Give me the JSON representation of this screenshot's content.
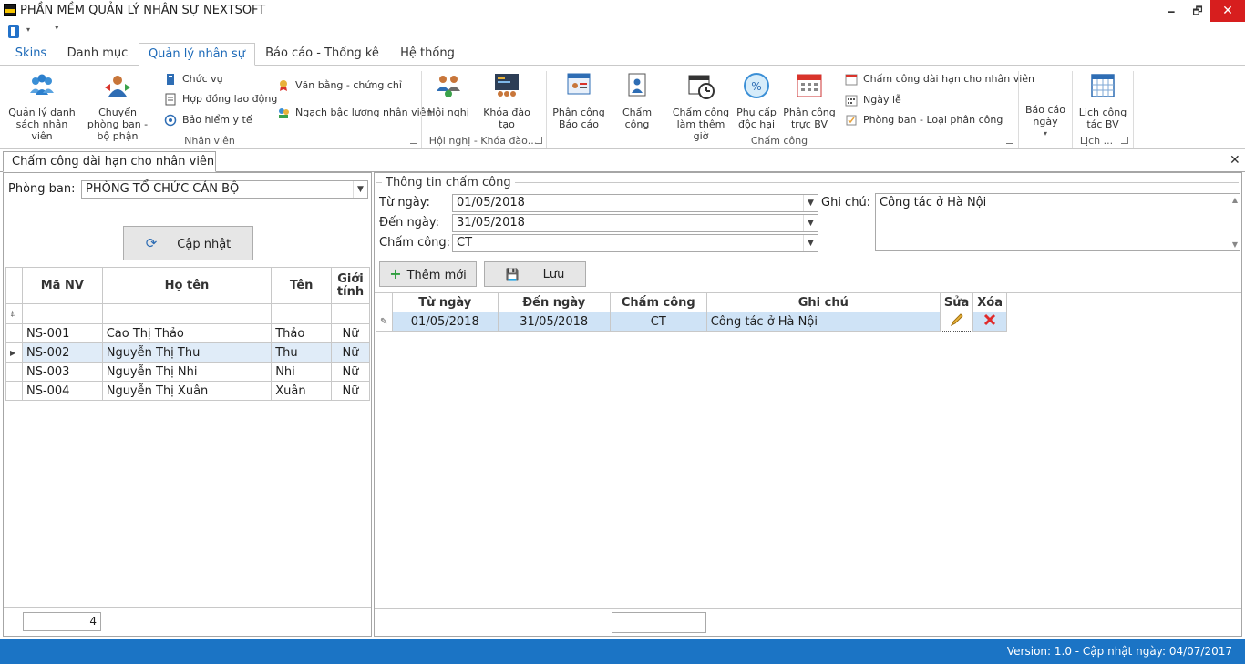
{
  "window": {
    "title": "PHẦN MỀM QUẢN LÝ NHÂN SỰ NEXTSOFT",
    "minimize": "🗕",
    "maximize": "🗗",
    "close": "✕"
  },
  "tabs": [
    "Skins",
    "Danh mục",
    "Quản lý nhân sự",
    "Báo cáo - Thống kê",
    "Hệ thống"
  ],
  "ribbon": {
    "nhanvien": {
      "label": "Nhân viên",
      "qlds": "Quản lý danh sách nhân viên",
      "chuyen": "Chuyển phòng ban - bộ phận",
      "chucvu": "Chức vụ",
      "hopdong": "Hợp đồng lao động",
      "baohiem": "Bảo hiểm y tế",
      "vanbang": "Văn bằng - chứng chỉ",
      "ngach": "Ngạch bậc lương nhân viên"
    },
    "hoinghi": {
      "label": "Hội nghị - Khóa đào...",
      "hoinghi": "Hội nghị",
      "khoadaotao": "Khóa đào tạo"
    },
    "chamcong": {
      "label": "Chấm công",
      "phancong_baocao": "Phân công Báo cáo",
      "chamcong": "Chấm công",
      "lamthemgio": "Chấm công làm thêm giờ",
      "phucap": "Phụ cấp độc hại",
      "phancong_truc": "Phân công trực BV",
      "daihan": "Chấm công dài hạn cho nhân viên",
      "ngayle": "Ngày lễ",
      "phongban_loai": "Phòng ban - Loại phân công"
    },
    "baocao_ngay": "Báo cáo ngày",
    "lich": {
      "label": "Lịch ...",
      "lichcongtac": "Lịch công tác BV"
    }
  },
  "document_tab": "Chấm công dài hạn cho nhân viên",
  "left": {
    "phongban_label": "Phòng ban:",
    "phongban_value": "PHÒNG TỔ CHỨC CÁN BỘ",
    "capnhat": "Cập nhật",
    "columns": [
      "Mã NV",
      "Họ tên",
      "Tên",
      "Giới tính"
    ],
    "rows": [
      {
        "ma": "NS-001",
        "hoten": "Cao Thị Thảo",
        "ten": "Thảo",
        "gt": "Nữ"
      },
      {
        "ma": "NS-002",
        "hoten": "Nguyễn Thị Thu",
        "ten": "Thu",
        "gt": "Nữ"
      },
      {
        "ma": "NS-003",
        "hoten": "Nguyễn Thị Nhi",
        "ten": "Nhi",
        "gt": "Nữ"
      },
      {
        "ma": "NS-004",
        "hoten": "Nguyễn Thị Xuân",
        "ten": "Xuân",
        "gt": "Nữ"
      }
    ],
    "count": "4"
  },
  "right": {
    "group_title": "Thông tin chấm công",
    "tungay_label": "Từ ngày:",
    "tungay": "01/05/2018",
    "denngay_label": "Đến ngày:",
    "denngay": "31/05/2018",
    "chamcong_label": "Chấm công:",
    "chamcong": "CT",
    "ghichu_label": "Ghi chú:",
    "ghichu": "Công tác ở Hà Nội",
    "themmoi": "Thêm mới",
    "luu": "Lưu",
    "columns": [
      "Từ ngày",
      "Đến ngày",
      "Chấm công",
      "Ghi chú",
      "Sửa",
      "Xóa"
    ],
    "rows": [
      {
        "tu": "01/05/2018",
        "den": "31/05/2018",
        "cc": "CT",
        "gc": "Công tác ở Hà Nội"
      }
    ]
  },
  "status": "Version: 1.0 - Cập nhật ngày: 04/07/2017",
  "colors": {
    "accent": "#1d6ab8",
    "status": "#1b74c5",
    "close": "#d71e1e"
  }
}
